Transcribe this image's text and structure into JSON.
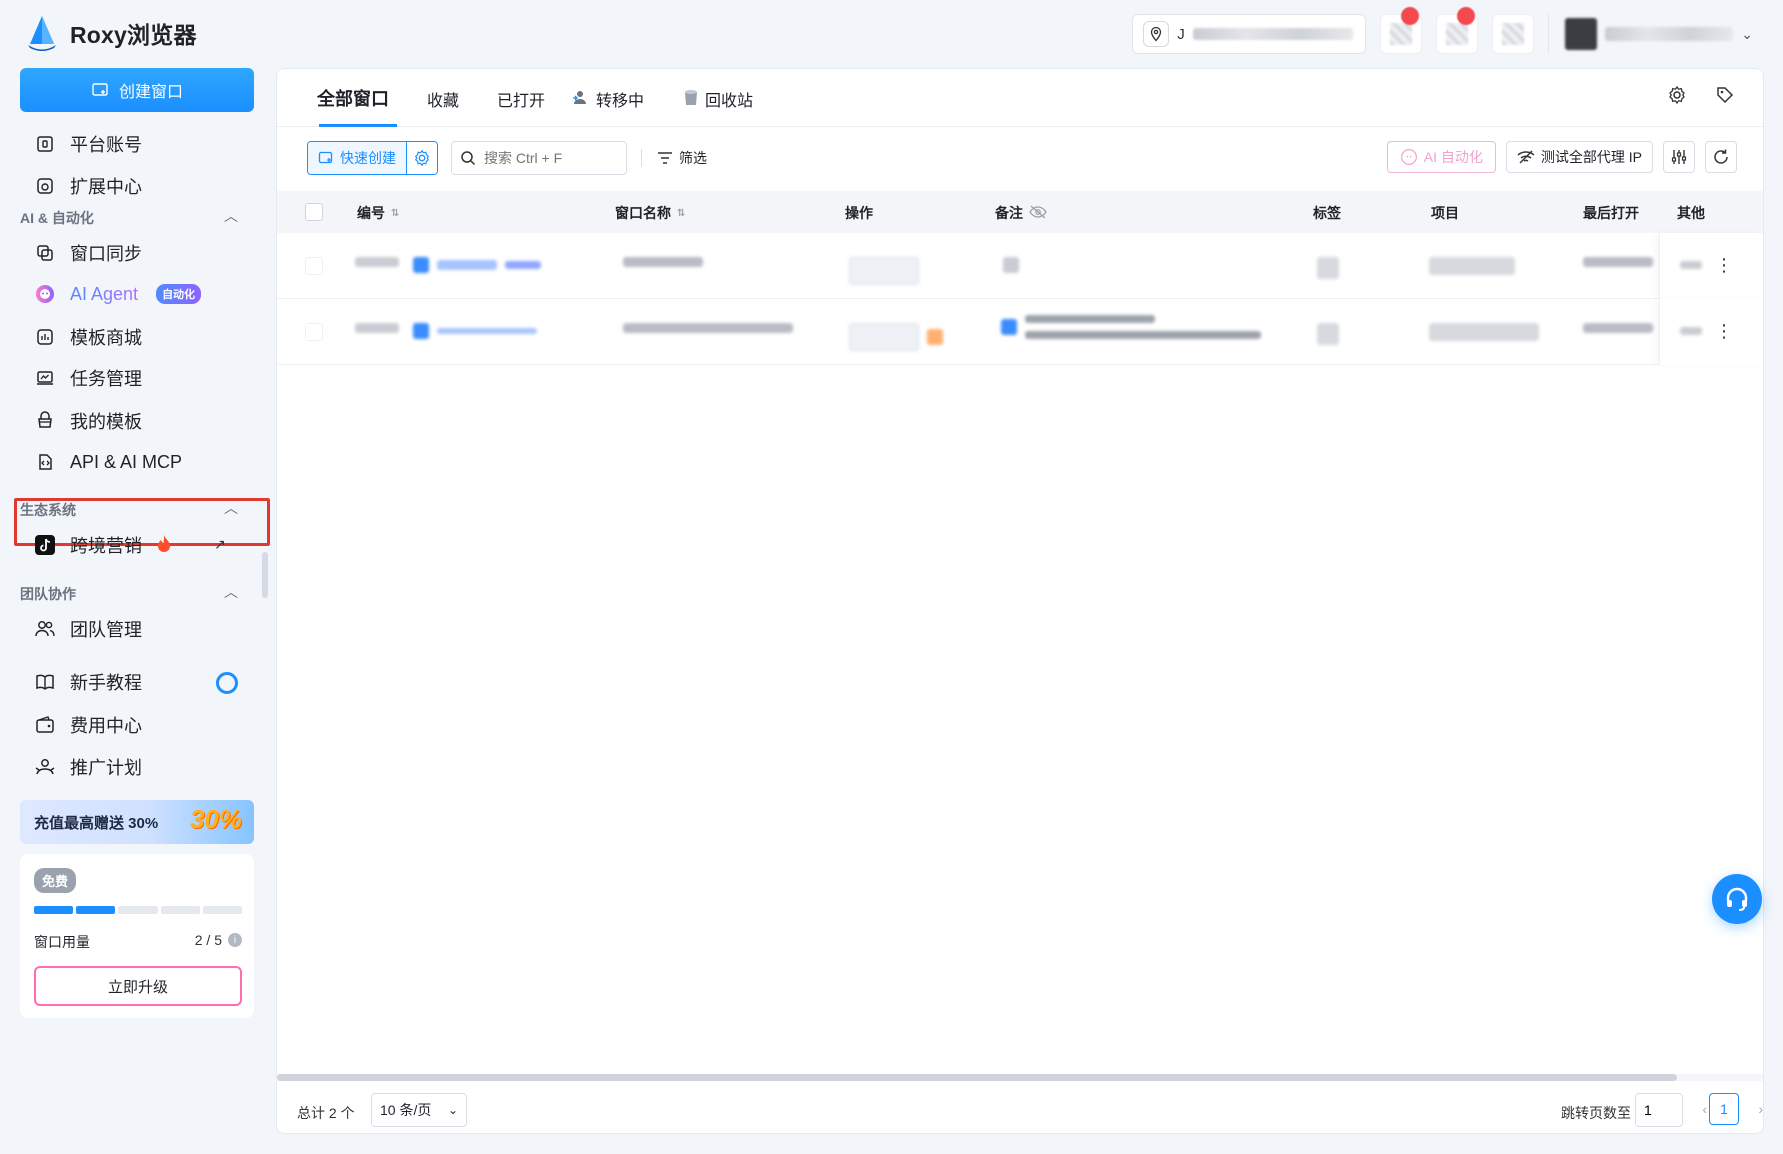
{
  "app": {
    "title": "Roxy浏览器"
  },
  "topbar": {
    "ip_prefix": "J",
    "notifications": 2
  },
  "sidebar": {
    "create_label": "创建窗口",
    "items_top": [
      {
        "label": "平台账号",
        "icon": "account-icon"
      },
      {
        "label": "扩展中心",
        "icon": "extension-icon"
      }
    ],
    "ai_section": "AI & 自动化",
    "ai_items": [
      {
        "label": "窗口同步",
        "icon": "sync-icon"
      },
      {
        "label": "AI Agent",
        "icon": "agent-icon",
        "badge": "自动化"
      },
      {
        "label": "模板商城",
        "icon": "store-icon"
      },
      {
        "label": "任务管理",
        "icon": "task-icon"
      },
      {
        "label": "我的模板",
        "icon": "template-icon"
      },
      {
        "label": "API & AI MCP",
        "icon": "api-icon"
      }
    ],
    "eco_section": "生态系统",
    "eco_items": [
      {
        "label": "跨境营销",
        "icon": "tiktok-icon"
      }
    ],
    "team_section": "团队协作",
    "team_items": [
      {
        "label": "团队管理",
        "icon": "team-icon"
      }
    ],
    "bottom_items": [
      {
        "label": "新手教程",
        "icon": "book-icon"
      },
      {
        "label": "费用中心",
        "icon": "wallet-icon"
      },
      {
        "label": "推广计划",
        "icon": "referral-icon"
      }
    ],
    "promo": {
      "text": "充值最高赠送 30%",
      "big": "30%"
    },
    "usage": {
      "plan": "免费",
      "label": "窗口用量",
      "value": "2 / 5",
      "used": 2,
      "total": 5,
      "upgrade": "立即升级"
    }
  },
  "tabs": [
    {
      "label": "全部窗口",
      "active": true
    },
    {
      "label": "收藏"
    },
    {
      "label": "已打开"
    },
    {
      "label": "转移中",
      "icon": "transfer-icon"
    },
    {
      "label": "回收站",
      "icon": "trash-icon"
    }
  ],
  "toolbar": {
    "quick_create": "快速创建",
    "search_placeholder": "搜索 Ctrl + F",
    "filter": "筛选",
    "ai_automation": "AI 自动化",
    "test_proxy": "测试全部代理 IP"
  },
  "table": {
    "columns": [
      "编号",
      "窗口名称",
      "操作",
      "备注",
      "标签",
      "项目",
      "最后打开",
      "其他"
    ],
    "row_count": 2
  },
  "footer": {
    "total": "总计 2 个",
    "page_size": "10 条/页",
    "jump_label": "跳转页数至",
    "jump_value": "1",
    "current_page": "1"
  },
  "colors": {
    "primary": "#1b8fff",
    "highlight": "#e03a2e",
    "upgrade_border": "#ff6fae"
  }
}
